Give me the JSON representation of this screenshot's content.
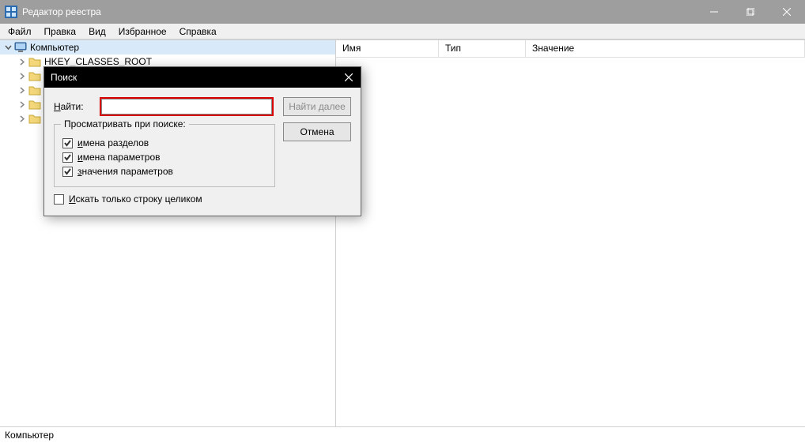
{
  "window": {
    "title": "Редактор реестра"
  },
  "menu": {
    "file": "Файл",
    "edit": "Правка",
    "view": "Вид",
    "favorites": "Избранное",
    "help": "Справка"
  },
  "tree": {
    "root_label": "Компьютер",
    "hk_classes": "HKEY_CLASSES_ROOT"
  },
  "list_headers": {
    "name": "Имя",
    "type": "Тип",
    "value": "Значение"
  },
  "statusbar": {
    "path": "Компьютер"
  },
  "dialog": {
    "title": "Поиск",
    "find_label": "Найти:",
    "search_value": "",
    "find_next_btn": "Найти далее",
    "cancel_btn": "Отмена",
    "lookat_legend": "Просматривать при поиске:",
    "chk_keys": "имена разделов",
    "chk_values": "имена параметров",
    "chk_data": "значения параметров",
    "whole_string": "Искать только строку целиком"
  }
}
